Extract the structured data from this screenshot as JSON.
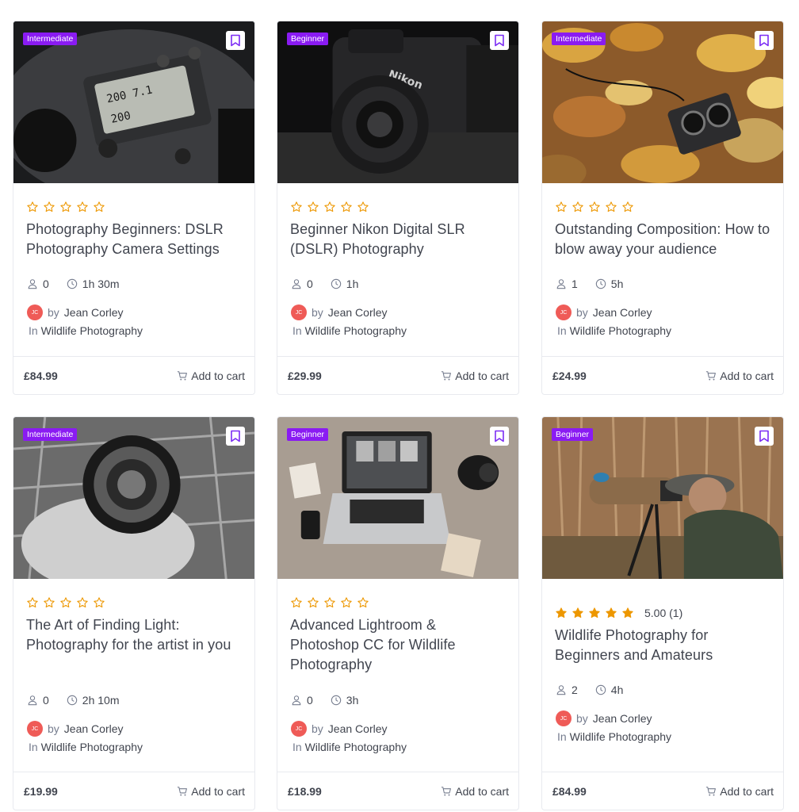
{
  "colors": {
    "accent_level": "#8a1bf2",
    "star": "#ed9700",
    "avatar": "#ef5b57"
  },
  "labels": {
    "by": "by",
    "in": "In",
    "add_to_cart": "Add to cart"
  },
  "courses": [
    {
      "level": "Intermediate",
      "rating": 0,
      "rating_text": "",
      "title": "Photography Beginners: DSLR Photography Camera Settings",
      "students": "0",
      "duration": "1h 30m",
      "author_initials": "JC",
      "author": "Jean Corley",
      "category": "Wildlife Photography",
      "price": "£84.99"
    },
    {
      "level": "Beginner",
      "rating": 0,
      "rating_text": "",
      "title": "Beginner Nikon Digital SLR (DSLR) Photography",
      "students": "0",
      "duration": "1h",
      "author_initials": "JC",
      "author": "Jean Corley",
      "category": "Wildlife Photography",
      "price": "£29.99"
    },
    {
      "level": "Intermediate",
      "rating": 0,
      "rating_text": "",
      "title": "Outstanding Composition: How to blow away your audience",
      "students": "1",
      "duration": "5h",
      "author_initials": "JC",
      "author": "Jean Corley",
      "category": "Wildlife Photography",
      "price": "£24.99"
    },
    {
      "level": "Intermediate",
      "rating": 0,
      "rating_text": "",
      "title": "The Art of Finding Light: Photography for the artist in you",
      "students": "0",
      "duration": "2h 10m",
      "author_initials": "JC",
      "author": "Jean Corley",
      "category": "Wildlife Photography",
      "price": "£19.99"
    },
    {
      "level": "Beginner",
      "rating": 0,
      "rating_text": "",
      "title": "Advanced Lightroom & Photoshop CC for Wildlife Photography",
      "students": "0",
      "duration": "3h",
      "author_initials": "JC",
      "author": "Jean Corley",
      "category": "Wildlife Photography",
      "price": "£18.99"
    },
    {
      "level": "Beginner",
      "rating": 5,
      "rating_text": "5.00 (1)",
      "title": "Wildlife Photography for Beginners and Amateurs",
      "students": "2",
      "duration": "4h",
      "author_initials": "JC",
      "author": "Jean Corley",
      "category": "Wildlife Photography",
      "price": "£84.99"
    }
  ]
}
